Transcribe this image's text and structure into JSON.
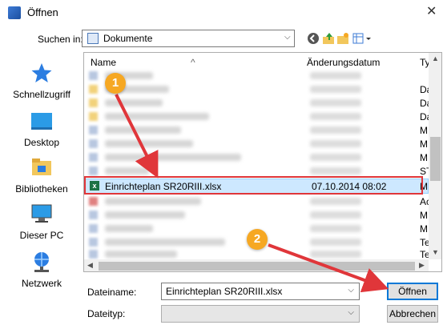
{
  "window": {
    "title": "Öffnen",
    "close_glyph": "✕"
  },
  "lookin": {
    "label": "Suchen in:",
    "value": "Dokumente"
  },
  "toolbar": {
    "icons": [
      "back-icon",
      "up-folder-icon",
      "new-folder-icon",
      "view-menu-icon"
    ]
  },
  "places": [
    {
      "label": "Schnellzugriff",
      "icon": "star-icon"
    },
    {
      "label": "Desktop",
      "icon": "desktop-icon"
    },
    {
      "label": "Bibliotheken",
      "icon": "library-icon"
    },
    {
      "label": "Dieser PC",
      "icon": "computer-icon"
    },
    {
      "label": "Netzwerk",
      "icon": "network-icon"
    }
  ],
  "columns": {
    "name": "Name",
    "date": "Änderungsdatum",
    "type": "Ty"
  },
  "rows_before": [
    {
      "type": ""
    },
    {
      "type": "Da"
    },
    {
      "type": "Da"
    },
    {
      "type": "Da"
    },
    {
      "type": "M"
    },
    {
      "type": "M"
    },
    {
      "type": "M"
    },
    {
      "type": "ST"
    }
  ],
  "selected_row": {
    "name": "Einrichteplan SR20RIII.xlsx",
    "date": "07.10.2014 08:02",
    "type": "M",
    "icon": "excel-icon"
  },
  "rows_after": [
    {
      "type": "Ac"
    },
    {
      "type": "M"
    },
    {
      "type": "M"
    },
    {
      "type": "Te"
    },
    {
      "type": "Te"
    },
    {
      "type": "Te"
    }
  ],
  "filename": {
    "label": "Dateiname:",
    "value": "Einrichteplan SR20RIII.xlsx"
  },
  "filetype": {
    "label": "Dateityp:",
    "value": ""
  },
  "buttons": {
    "open": "Öffnen",
    "cancel": "Abbrechen"
  },
  "annotations": {
    "badge1": "1",
    "badge2": "2",
    "color": "#e0363a",
    "badge_color": "#f6a823"
  }
}
